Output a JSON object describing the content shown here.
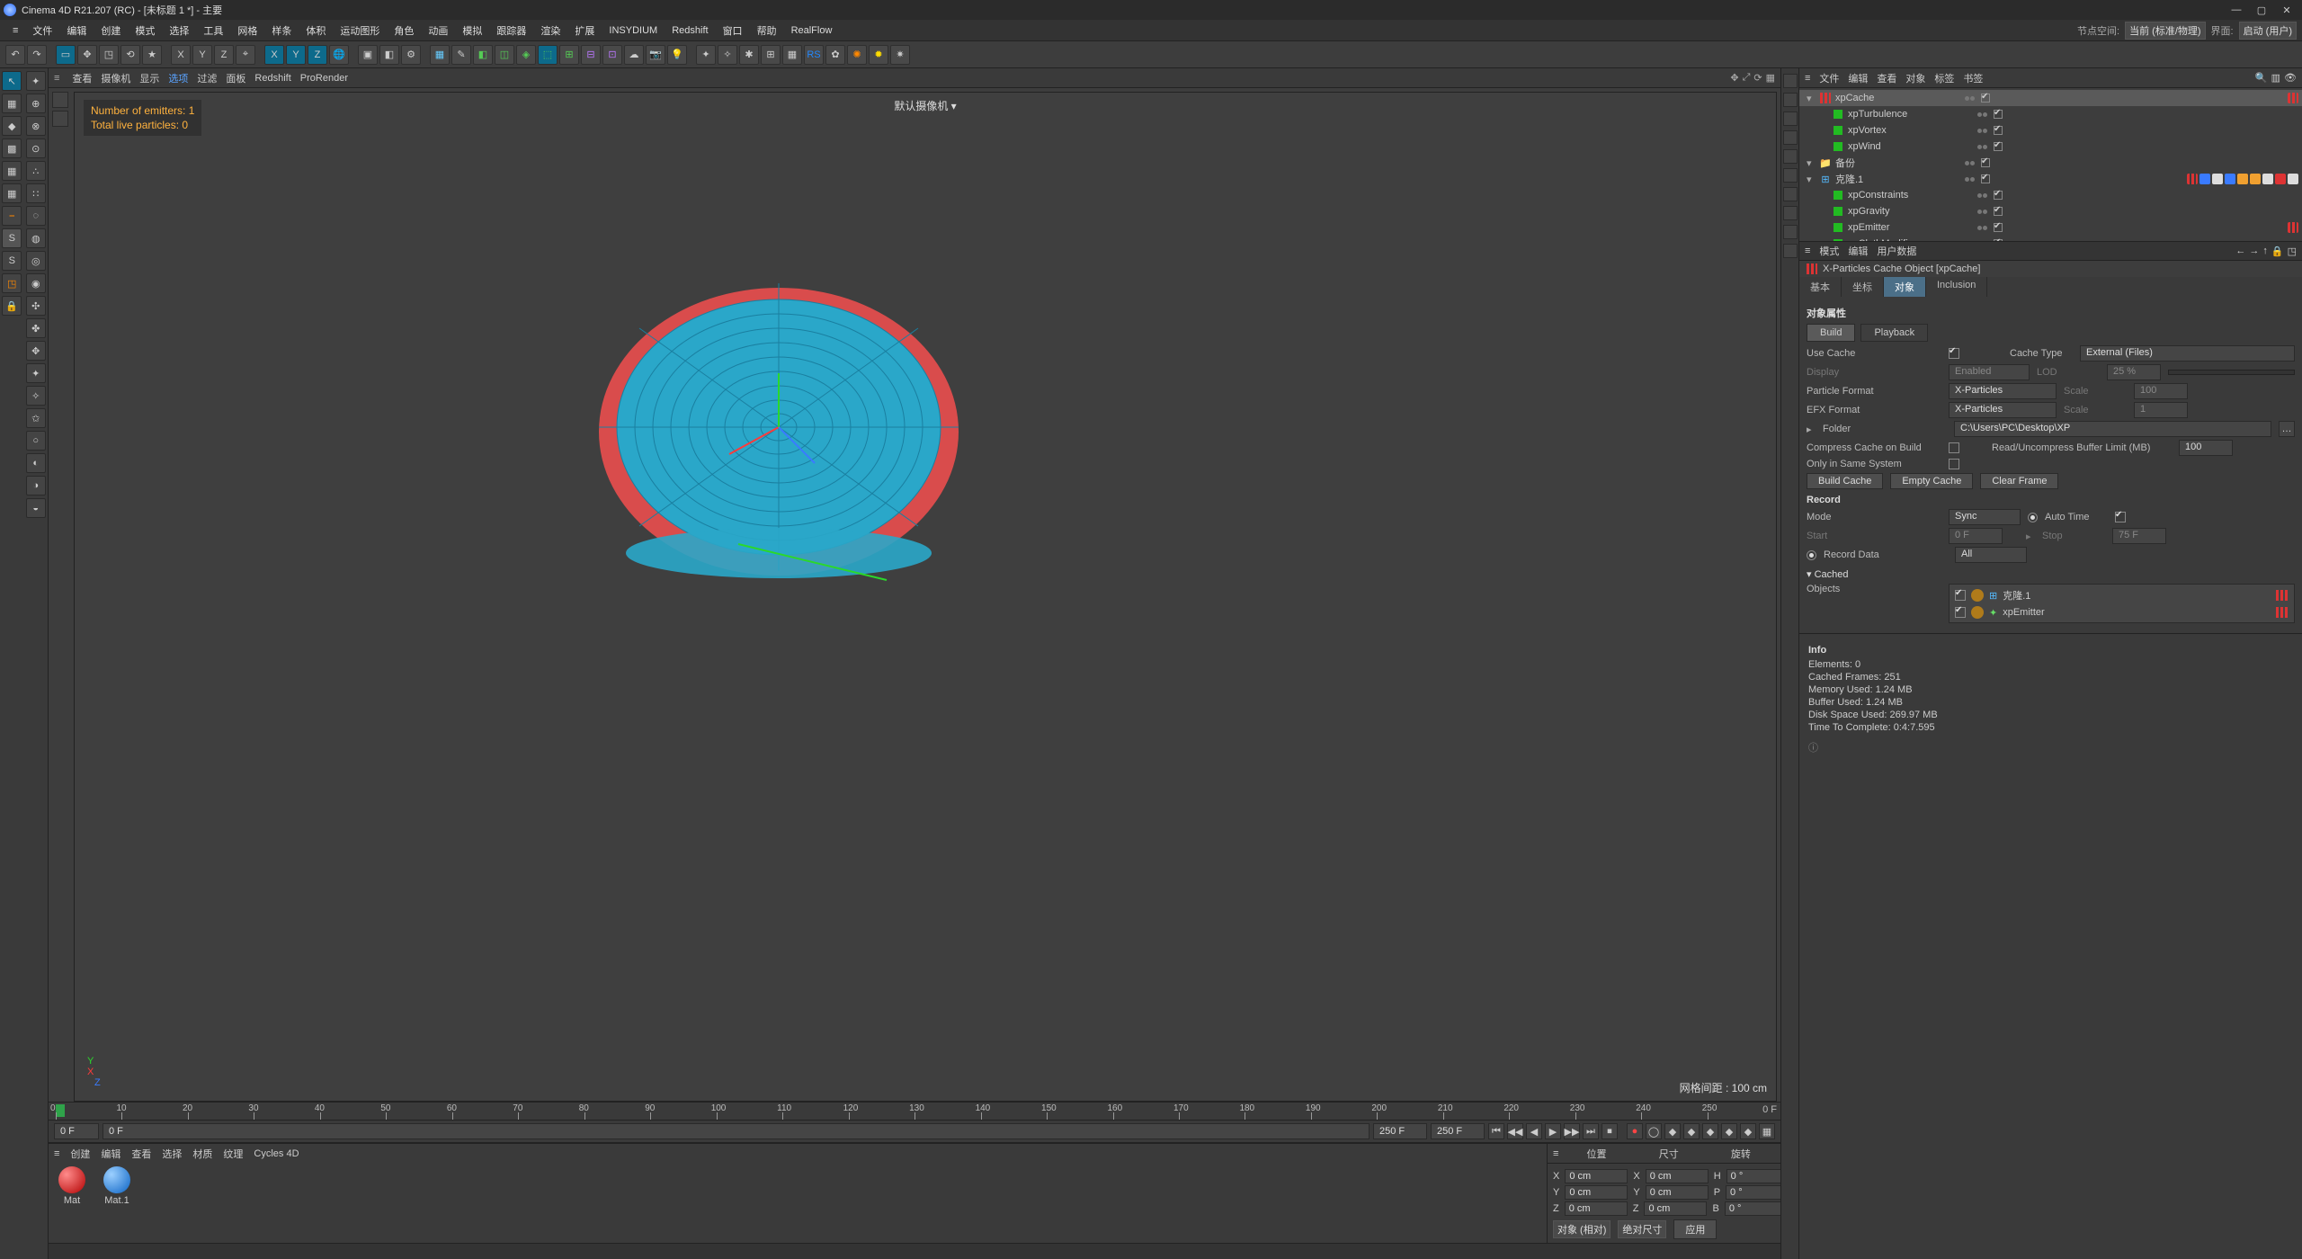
{
  "title": "Cinema 4D R21.207 (RC) - [未标题 1 *] - 主要",
  "menubar": [
    "文件",
    "编辑",
    "创建",
    "模式",
    "选择",
    "工具",
    "网格",
    "样条",
    "体积",
    "运动图形",
    "角色",
    "动画",
    "模拟",
    "跟踪器",
    "渲染",
    "扩展",
    "INSYDIUM",
    "Redshift",
    "窗口",
    "帮助",
    "RealFlow"
  ],
  "menubar_right": {
    "node_space": "节点空间:",
    "node_value": "当前 (标准/物理)",
    "layout": "界面:",
    "layout_value": "启动 (用户)"
  },
  "view_tabs": [
    "查看",
    "摄像机",
    "显示",
    "选项",
    "过滤",
    "面板",
    "Redshift",
    "ProRender"
  ],
  "view_tabs_active": "选项",
  "hud": {
    "emitters": "Number of emitters: 1",
    "live": "Total live particles: 0"
  },
  "camera_label": "默认摄像机 ▾",
  "grid_label": "网格间距 : 100 cm",
  "timeline": {
    "ticks": [
      0,
      10,
      20,
      30,
      40,
      50,
      60,
      70,
      80,
      90,
      100,
      110,
      120,
      130,
      140,
      150,
      160,
      170,
      180,
      190,
      200,
      210,
      220,
      230,
      240,
      250
    ],
    "end": "0 F",
    "cur": "0 F",
    "start": "0 F",
    "range_end": "250 F",
    "range_end2": "250 F"
  },
  "mat_menu": [
    "创建",
    "编辑",
    "查看",
    "选择",
    "材质",
    "纹理",
    "Cycles 4D"
  ],
  "materials": [
    {
      "name": "Mat",
      "color": "red"
    },
    {
      "name": "Mat.1",
      "color": "blue"
    }
  ],
  "coords": {
    "hdr": [
      "位置",
      "尺寸",
      "旋转"
    ],
    "rows": [
      {
        "ax": "X",
        "p": "0 cm",
        "s": "0 cm",
        "r": "0 °",
        "rl": "H"
      },
      {
        "ax": "Y",
        "p": "0 cm",
        "s": "0 cm",
        "r": "0 °",
        "rl": "P"
      },
      {
        "ax": "Z",
        "p": "0 cm",
        "s": "0 cm",
        "r": "0 °",
        "rl": "B"
      }
    ],
    "sel1": "对象 (相对)",
    "sel2": "绝对尺寸",
    "apply": "应用"
  },
  "om_menu": [
    "文件",
    "编辑",
    "查看",
    "对象",
    "标签",
    "书签"
  ],
  "om": [
    {
      "name": "xpCache",
      "icon": "bars",
      "sel": true,
      "indent": 0,
      "tags": [
        "bars"
      ]
    },
    {
      "name": "xpTurbulence",
      "icon": "grn",
      "indent": 1
    },
    {
      "name": "xpVortex",
      "icon": "grn",
      "indent": 1
    },
    {
      "name": "xpWind",
      "icon": "grn",
      "indent": 1
    },
    {
      "name": "备份",
      "icon": "fld",
      "indent": 0
    },
    {
      "name": "克隆.1",
      "icon": "cln",
      "indent": 0,
      "tags": [
        "bars",
        "blue",
        "wht",
        "blue",
        "org",
        "org",
        "wht",
        "red",
        "wht"
      ]
    },
    {
      "name": "xpConstraints",
      "icon": "grn",
      "indent": 1
    },
    {
      "name": "xpGravity",
      "icon": "grn",
      "indent": 1
    },
    {
      "name": "xpEmitter",
      "icon": "grn",
      "indent": 1,
      "tags": [
        "bars"
      ]
    },
    {
      "name": "xpClothModifier",
      "icon": "grn",
      "indent": 1
    }
  ],
  "attr_menu": [
    "模式",
    "编辑",
    "用户数据"
  ],
  "attr_title": "X-Particles Cache Object [xpCache]",
  "attr_tabs": [
    "基本",
    "坐标",
    "对象",
    "Inclusion"
  ],
  "attr_tab_active": "对象",
  "attr": {
    "section": "对象属性",
    "subtabs": [
      "Build",
      "Playback"
    ],
    "subtab_active": "Build",
    "use_cache": "Use Cache",
    "cache_type": "Cache Type",
    "cache_type_val": "External (Files)",
    "display": "Display",
    "display_val": "Enabled",
    "lod": "LOD",
    "lod_val": "25 %",
    "pformat": "Particle Format",
    "pformat_val": "X-Particles",
    "scale": "Scale",
    "scale_val": "100",
    "efx": "EFX Format",
    "efx_val": "X-Particles",
    "scale2": "Scale",
    "scale2_val": "1",
    "folder": "Folder",
    "folder_val": "C:\\Users\\PC\\Desktop\\XP",
    "compress": "Compress Cache on Build",
    "buffer": "Read/Uncompress Buffer Limit (MB)",
    "buffer_val": "100",
    "only_same": "Only in Same System",
    "b_build": "Build Cache",
    "b_empty": "Empty Cache",
    "b_clear": "Clear Frame",
    "record": "Record",
    "mode": "Mode",
    "mode_val": "Sync",
    "auto": "Auto Time",
    "start": "Start",
    "start_val": "0 F",
    "stop": "Stop",
    "stop_val": "75 F",
    "rdata": "Record Data",
    "rdata_val": "All",
    "cached": "Cached",
    "objects": "Objects",
    "cache_items": [
      {
        "name": "克隆.1"
      },
      {
        "name": "xpEmitter"
      }
    ]
  },
  "info": {
    "title": "Info",
    "lines": [
      "Elements: 0",
      "Cached Frames: 251",
      "Memory Used: 1.24 MB",
      "Buffer Used: 1.24 MB",
      "Disk Space Used: 269.97 MB",
      "Time To Complete: 0:4:7.595"
    ]
  }
}
